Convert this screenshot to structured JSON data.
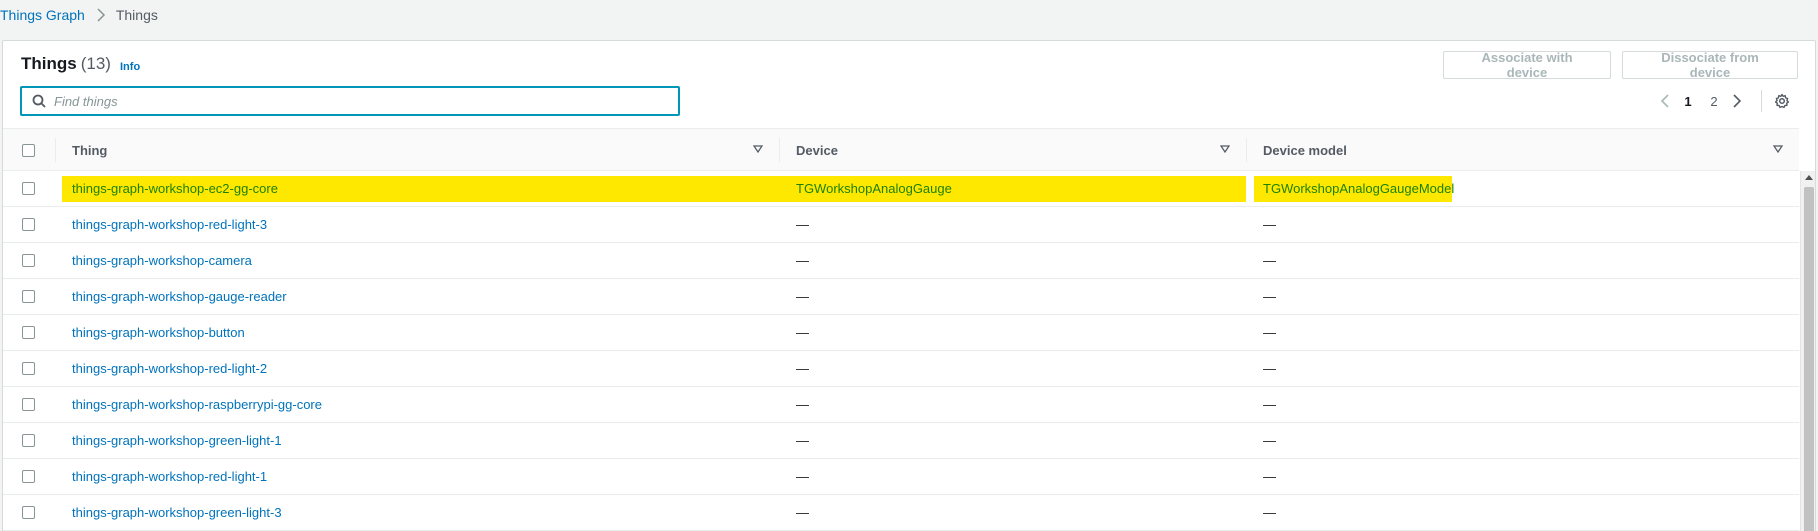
{
  "breadcrumb": {
    "parent": "Things Graph",
    "current": "Things"
  },
  "header": {
    "title": "Things",
    "count": "(13)",
    "info_label": "Info",
    "associate_label": "Associate with device",
    "dissociate_label": "Dissociate from device"
  },
  "search": {
    "placeholder": "Find things",
    "value": ""
  },
  "pagination": {
    "current_page": "1",
    "next_page": "2"
  },
  "table": {
    "columns": [
      "Thing",
      "Device",
      "Device model"
    ],
    "rows": [
      {
        "thing": "things-graph-workshop-ec2-gg-core",
        "device": "TGWorkshopAnalogGauge",
        "model": "TGWorkshopAnalogGaugeModel"
      },
      {
        "thing": "things-graph-workshop-red-light-3",
        "device": "—",
        "model": "—"
      },
      {
        "thing": "things-graph-workshop-camera",
        "device": "—",
        "model": "—"
      },
      {
        "thing": "things-graph-workshop-gauge-reader",
        "device": "—",
        "model": "—"
      },
      {
        "thing": "things-graph-workshop-button",
        "device": "—",
        "model": "—"
      },
      {
        "thing": "things-graph-workshop-red-light-2",
        "device": "—",
        "model": "—"
      },
      {
        "thing": "things-graph-workshop-raspberrypi-gg-core",
        "device": "—",
        "model": "—"
      },
      {
        "thing": "things-graph-workshop-green-light-1",
        "device": "—",
        "model": "—"
      },
      {
        "thing": "things-graph-workshop-red-light-1",
        "device": "—",
        "model": "—"
      },
      {
        "thing": "things-graph-workshop-green-light-3",
        "device": "—",
        "model": "—"
      }
    ]
  },
  "colors": {
    "link": "#0073bb",
    "highlight": "#ffe800",
    "search_border": "#0096b8"
  }
}
